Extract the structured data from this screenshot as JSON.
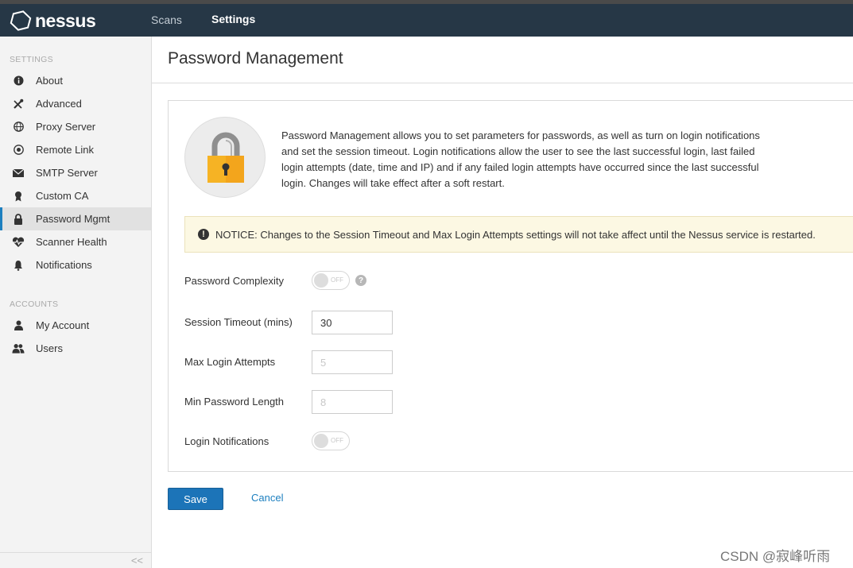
{
  "app": {
    "name": "nessus"
  },
  "nav": {
    "scans": "Scans",
    "settings": "Settings"
  },
  "sidebar": {
    "settings_heading": "SETTINGS",
    "settings_items": [
      {
        "label": "About",
        "icon": "info-icon"
      },
      {
        "label": "Advanced",
        "icon": "tools-icon"
      },
      {
        "label": "Proxy Server",
        "icon": "globe-icon"
      },
      {
        "label": "Remote Link",
        "icon": "remote-link-icon"
      },
      {
        "label": "SMTP Server",
        "icon": "envelope-icon"
      },
      {
        "label": "Custom CA",
        "icon": "certificate-icon"
      },
      {
        "label": "Password Mgmt",
        "icon": "lock-icon",
        "active": true
      },
      {
        "label": "Scanner Health",
        "icon": "heartbeat-icon"
      },
      {
        "label": "Notifications",
        "icon": "bell-icon"
      }
    ],
    "accounts_heading": "ACCOUNTS",
    "accounts_items": [
      {
        "label": "My Account",
        "icon": "user-icon"
      },
      {
        "label": "Users",
        "icon": "users-icon"
      }
    ],
    "collapse": "<<"
  },
  "page": {
    "title": "Password Management",
    "intro": "Password Management allows you to set parameters for passwords, as well as turn on login notifications and set the session timeout. Login notifications allow the user to see the last successful login, last failed login attempts (date, time and IP) and if any failed login attempts have occurred since the last successful login. Changes will take effect after a soft restart.",
    "notice": "NOTICE: Changes to the Session Timeout and Max Login Attempts settings will not take affect until the Nessus service is restarted."
  },
  "form": {
    "password_complexity": {
      "label": "Password Complexity",
      "state": "OFF"
    },
    "session_timeout": {
      "label": "Session Timeout (mins)",
      "value": "30"
    },
    "max_login_attempts": {
      "label": "Max Login Attempts",
      "placeholder": "5"
    },
    "min_password_length": {
      "label": "Min Password Length",
      "placeholder": "8"
    },
    "login_notifications": {
      "label": "Login Notifications",
      "state": "OFF"
    }
  },
  "actions": {
    "save": "Save",
    "cancel": "Cancel"
  },
  "watermark": "CSDN @寂峰听雨",
  "colors": {
    "topbar": "#263746",
    "accent": "#1c7fbf",
    "save_button": "#1c74b8",
    "notice_bg": "#fcf8e3",
    "lock": "#f6b324"
  }
}
